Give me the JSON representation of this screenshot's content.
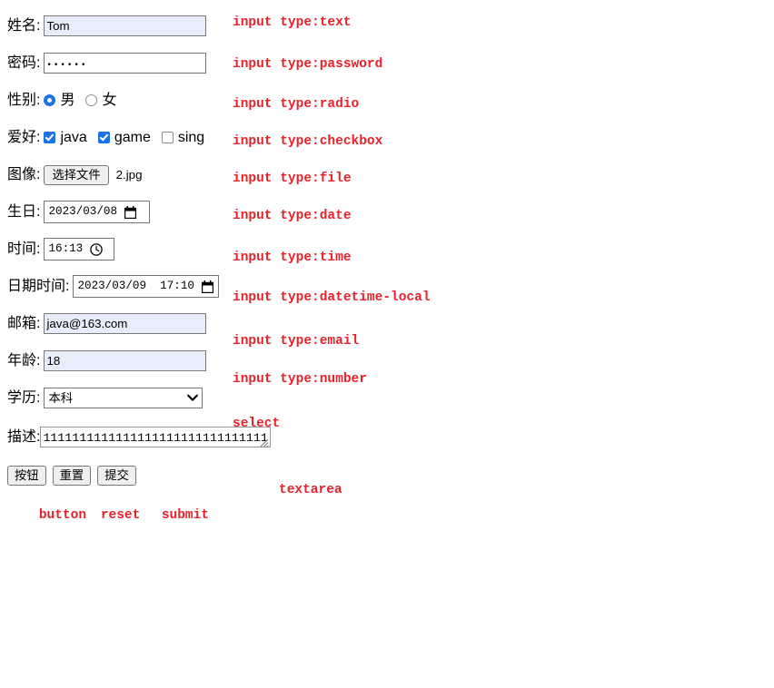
{
  "form": {
    "rows": [
      {
        "label": "姓名:",
        "control": "text",
        "value": "Tom",
        "note": "input type:text"
      },
      {
        "label": "密码:",
        "control": "password",
        "value": "••••••",
        "note": "input type:password"
      },
      {
        "label": "性别:",
        "control": "radio",
        "options": [
          {
            "label": "男",
            "checked": true
          },
          {
            "label": "女",
            "checked": false
          }
        ],
        "note": "input type:radio"
      },
      {
        "label": "爱好:",
        "control": "checkbox",
        "options": [
          {
            "label": "java",
            "checked": true
          },
          {
            "label": "game",
            "checked": true
          },
          {
            "label": "sing",
            "checked": false
          }
        ],
        "note": "input type:checkbox"
      },
      {
        "label": "图像:",
        "control": "file",
        "button_label": "选择文件",
        "file_name": "2.jpg",
        "note": "input type:file"
      },
      {
        "label": "生日:",
        "control": "date",
        "value": "2023/03/08",
        "icon": "calendar-icon",
        "note": "input type:date"
      },
      {
        "label": "时间:",
        "control": "time",
        "value": "16:13",
        "icon": "clock-icon",
        "note": "input type:time"
      },
      {
        "label": "日期时间:",
        "control": "datetime-local",
        "value": "2023/03/09  17:10",
        "icon": "calendar-icon",
        "note": "input type:datetime-local"
      },
      {
        "label": "邮箱:",
        "control": "email",
        "value": "java@163.com",
        "note": "input type:email"
      },
      {
        "label": "年龄:",
        "control": "number",
        "value": "18",
        "note": "input type:number"
      },
      {
        "label": "学历:",
        "control": "select",
        "value": "本科",
        "note": "select"
      }
    ],
    "textarea": {
      "label": "描述:",
      "value": "1111111111111111111111111111111",
      "note": "textarea"
    },
    "buttons": [
      {
        "label": "按钮",
        "note": "button"
      },
      {
        "label": "重置",
        "note": "reset"
      },
      {
        "label": "提交",
        "note": "submit"
      }
    ]
  },
  "colors": {
    "annotation": "#e8222a",
    "autofill_background": "#e8edfb",
    "control_accent": "#1a73e8",
    "border": "#767676"
  }
}
